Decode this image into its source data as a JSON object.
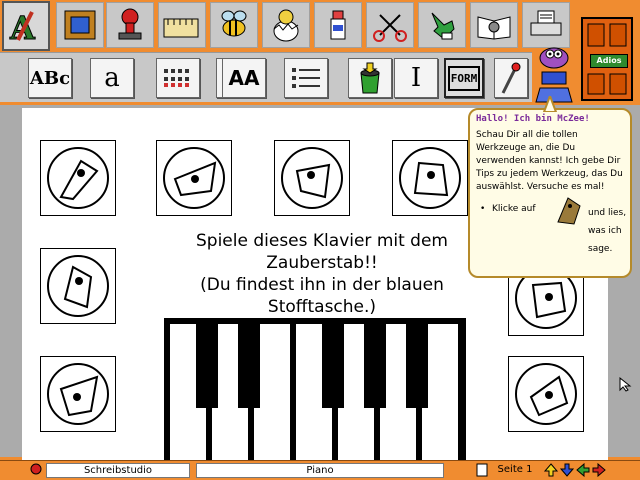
{
  "top_tools": [
    {
      "icon": "letter-a-brush-icon",
      "selected": true
    },
    {
      "icon": "picture-frame-icon"
    },
    {
      "icon": "stamp-icon"
    },
    {
      "icon": "ruler-book-icon"
    },
    {
      "icon": "bee-icon"
    },
    {
      "icon": "egg-hatching-icon"
    },
    {
      "icon": "glue-bottle-icon"
    },
    {
      "icon": "scissors-icon"
    },
    {
      "icon": "glove-hand-icon"
    },
    {
      "icon": "open-book-icon"
    },
    {
      "icon": "printer-icon"
    }
  ],
  "second_tools": [
    {
      "icon": "abc-letters-icon",
      "text": "ABc"
    },
    {
      "icon": "magic-letter-a-icon",
      "text": "a"
    },
    {
      "icon": "text-lines-icon",
      "text": ""
    },
    {
      "icon": "text-grid-icon",
      "text": ""
    },
    {
      "icon": "font-size-icon",
      "text": "AA"
    },
    {
      "icon": "bullet-list-icon",
      "text": ""
    },
    {
      "icon": "paint-bucket-icon",
      "text": ""
    },
    {
      "icon": "text-cursor-icon",
      "text": "I"
    },
    {
      "icon": "form-icon",
      "text": "FORM",
      "selected": true
    },
    {
      "icon": "magic-wand-icon",
      "text": ""
    }
  ],
  "exit": {
    "label": "Adios"
  },
  "main_text": {
    "line1": "Spiele dieses Klavier mit dem",
    "line2": "Zauberstab!!",
    "line3": "(Du findest ihn in der blauen",
    "line4": "Stofftasche.)"
  },
  "bubble": {
    "title": "Hallo! Ich bin McZee!",
    "body": "Schau Dir all die tollen Werkzeuge an, die Du verwenden kannst! Ich gebe Dir Tips zu jedem Werkzeug, das Du auswählst. Versuche es mal!",
    "bullet_prefix": "Klicke auf",
    "bullet_suffix": "und lies, was ich sage."
  },
  "status": {
    "studio": "Schreibstudio",
    "document": "Piano",
    "page": "Seite 1"
  },
  "colors": {
    "frame_orange": "#f08c30",
    "toolbar_gray": "#c8c8c8",
    "bubble_title": "#7a2a9a"
  }
}
